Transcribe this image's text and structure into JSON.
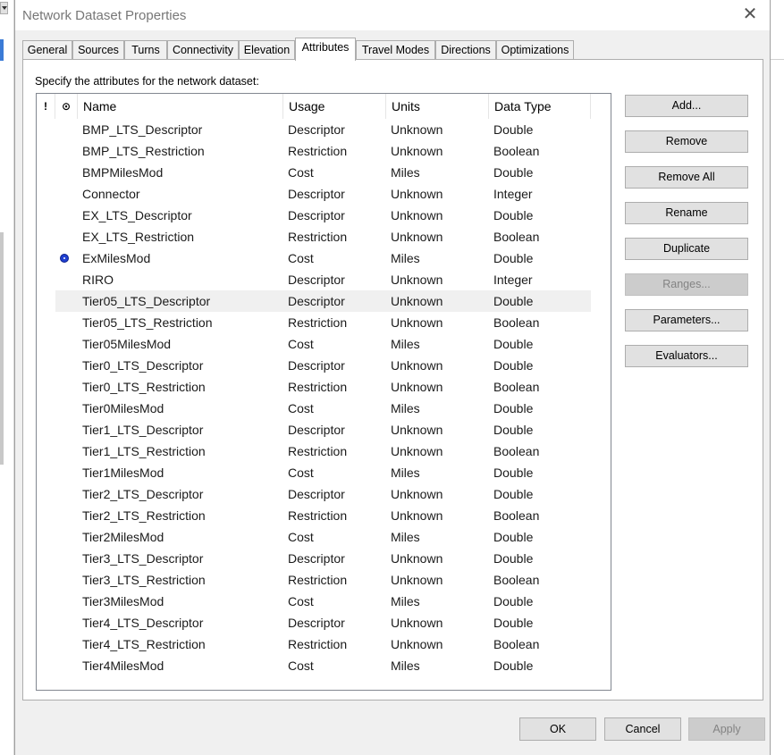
{
  "dialog": {
    "title": "Network Dataset Properties",
    "close_glyph": "✕"
  },
  "tabs": [
    {
      "label": "General"
    },
    {
      "label": "Sources"
    },
    {
      "label": "Turns"
    },
    {
      "label": "Connectivity"
    },
    {
      "label": "Elevation"
    },
    {
      "label": "Attributes",
      "active": true
    },
    {
      "label": "Travel Modes"
    },
    {
      "label": "Directions"
    },
    {
      "label": "Optimizations"
    }
  ],
  "attributes_tab": {
    "instruction": "Specify the attributes for the network dataset:",
    "columns": {
      "warning_icon": "!",
      "default_icon": "⊙",
      "name": "Name",
      "usage": "Usage",
      "units": "Units",
      "data_type": "Data Type"
    },
    "rows": [
      {
        "name": "BMP_LTS_Descriptor",
        "usage": "Descriptor",
        "units": "Unknown",
        "data_type": "Double"
      },
      {
        "name": "BMP_LTS_Restriction",
        "usage": "Restriction",
        "units": "Unknown",
        "data_type": "Boolean"
      },
      {
        "name": "BMPMilesMod",
        "usage": "Cost",
        "units": "Miles",
        "data_type": "Double"
      },
      {
        "name": "Connector",
        "usage": "Descriptor",
        "units": "Unknown",
        "data_type": "Integer"
      },
      {
        "name": "EX_LTS_Descriptor",
        "usage": "Descriptor",
        "units": "Unknown",
        "data_type": "Double"
      },
      {
        "name": "EX_LTS_Restriction",
        "usage": "Restriction",
        "units": "Unknown",
        "data_type": "Boolean"
      },
      {
        "name": "ExMilesMod",
        "usage": "Cost",
        "units": "Miles",
        "data_type": "Double",
        "default": true
      },
      {
        "name": "RIRO",
        "usage": "Descriptor",
        "units": "Unknown",
        "data_type": "Integer"
      },
      {
        "name": "Tier05_LTS_Descriptor",
        "usage": "Descriptor",
        "units": "Unknown",
        "data_type": "Double",
        "selected": true
      },
      {
        "name": "Tier05_LTS_Restriction",
        "usage": "Restriction",
        "units": "Unknown",
        "data_type": "Boolean"
      },
      {
        "name": "Tier05MilesMod",
        "usage": "Cost",
        "units": "Miles",
        "data_type": "Double"
      },
      {
        "name": "Tier0_LTS_Descriptor",
        "usage": "Descriptor",
        "units": "Unknown",
        "data_type": "Double"
      },
      {
        "name": "Tier0_LTS_Restriction",
        "usage": "Restriction",
        "units": "Unknown",
        "data_type": "Boolean"
      },
      {
        "name": "Tier0MilesMod",
        "usage": "Cost",
        "units": "Miles",
        "data_type": "Double"
      },
      {
        "name": "Tier1_LTS_Descriptor",
        "usage": "Descriptor",
        "units": "Unknown",
        "data_type": "Double"
      },
      {
        "name": "Tier1_LTS_Restriction",
        "usage": "Restriction",
        "units": "Unknown",
        "data_type": "Boolean"
      },
      {
        "name": "Tier1MilesMod",
        "usage": "Cost",
        "units": "Miles",
        "data_type": "Double"
      },
      {
        "name": "Tier2_LTS_Descriptor",
        "usage": "Descriptor",
        "units": "Unknown",
        "data_type": "Double"
      },
      {
        "name": "Tier2_LTS_Restriction",
        "usage": "Restriction",
        "units": "Unknown",
        "data_type": "Boolean"
      },
      {
        "name": "Tier2MilesMod",
        "usage": "Cost",
        "units": "Miles",
        "data_type": "Double"
      },
      {
        "name": "Tier3_LTS_Descriptor",
        "usage": "Descriptor",
        "units": "Unknown",
        "data_type": "Double"
      },
      {
        "name": "Tier3_LTS_Restriction",
        "usage": "Restriction",
        "units": "Unknown",
        "data_type": "Boolean"
      },
      {
        "name": "Tier3MilesMod",
        "usage": "Cost",
        "units": "Miles",
        "data_type": "Double"
      },
      {
        "name": "Tier4_LTS_Descriptor",
        "usage": "Descriptor",
        "units": "Unknown",
        "data_type": "Double"
      },
      {
        "name": "Tier4_LTS_Restriction",
        "usage": "Restriction",
        "units": "Unknown",
        "data_type": "Boolean"
      },
      {
        "name": "Tier4MilesMod",
        "usage": "Cost",
        "units": "Miles",
        "data_type": "Double"
      }
    ],
    "side_buttons": [
      {
        "label": "Add...",
        "enabled": true
      },
      {
        "label": "Remove",
        "enabled": true
      },
      {
        "label": "Remove All",
        "enabled": true
      },
      {
        "label": "Rename",
        "enabled": true
      },
      {
        "label": "Duplicate",
        "enabled": true
      },
      {
        "label": "Ranges...",
        "enabled": false
      },
      {
        "label": "Parameters...",
        "enabled": true
      },
      {
        "label": "Evaluators...",
        "enabled": true
      }
    ]
  },
  "footer": {
    "ok": "OK",
    "cancel": "Cancel",
    "apply": "Apply",
    "apply_enabled": false
  },
  "colors": {
    "selected_row": "#f0f0f0",
    "default_marker": "#1f3fd0",
    "disabled_button": "#cccccc"
  }
}
